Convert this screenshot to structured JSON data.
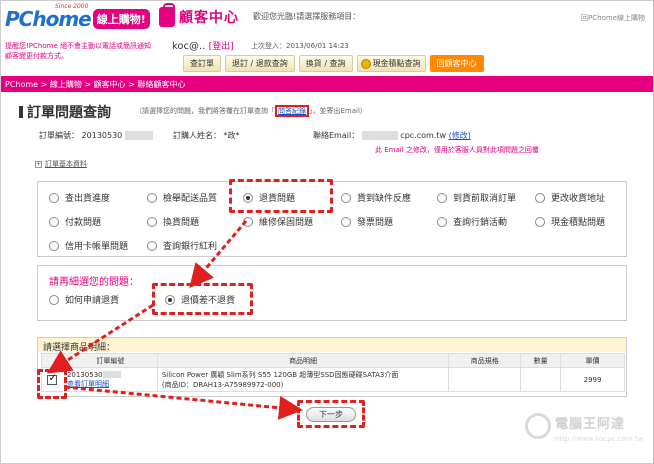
{
  "header": {
    "logo_text": "PChome",
    "since": "Since 2000",
    "shop_badge": "線上購物!",
    "cs_title": "顧客中心",
    "welcome": "歡迎您光臨!請選擇服務項目：",
    "top_link": "回PChome線上購物",
    "warning": "提醒您!PChome 絕不會主動以電話或簡訊通知顧客變更付款方式。",
    "user": "koc@..",
    "logout": "[登出]",
    "last_login": "上次登入：2013/06/01 14:23"
  },
  "tabs": [
    {
      "label": "查訂單"
    },
    {
      "label": "退訂 / 退款查詢"
    },
    {
      "label": "換貨 / 查詢"
    },
    {
      "label": "現金積點查詢"
    },
    {
      "label": "回顧客中心"
    }
  ],
  "breadcrumb": "PChome > 線上購物 > 顧客中心 > 聯絡顧客中心",
  "main": {
    "title": "訂單問題查詢",
    "hint_pre": "（請選擇您的問題，我們將答覆在訂單查詢「",
    "hint_link": "問答紀錄",
    "hint_post": "」，並寄出Email）",
    "order_no_label": "訂單編號：",
    "order_no_value": "20130530",
    "buyer_label": "訂購人姓名：",
    "buyer_value": "*政*",
    "email_label": "聯絡Email：",
    "email_value": "cpc.com.tw",
    "email_edit": "(修改)",
    "email_note": "此 Email 之修改，僅用於客服人員對此項問題之回覆",
    "order_basic": "訂單基本資料"
  },
  "problems": [
    {
      "label": "查出貨進度",
      "selected": false
    },
    {
      "label": "檢舉配送品質",
      "selected": false
    },
    {
      "label": "退貨問題",
      "selected": true
    },
    {
      "label": "貨到缺件反應",
      "selected": false
    },
    {
      "label": "到貨前取消訂單",
      "selected": false
    },
    {
      "label": "更改收貨地址",
      "selected": false
    },
    {
      "label": "付款問題",
      "selected": false
    },
    {
      "label": "換貨問題",
      "selected": false
    },
    {
      "label": "維修保固問題",
      "selected": false
    },
    {
      "label": "發票問題",
      "selected": false
    },
    {
      "label": "查詢行銷活動",
      "selected": false
    },
    {
      "label": "現金積點問題",
      "selected": false
    },
    {
      "label": "信用卡帳單問題",
      "selected": false
    },
    {
      "label": "查詢銀行紅利",
      "selected": false
    }
  ],
  "sub": {
    "question": "請再細選您的問題：",
    "options": [
      {
        "label": "如何申請退貨",
        "selected": false
      },
      {
        "label": "退價差不退貨",
        "selected": true
      }
    ]
  },
  "product": {
    "question": "請選擇商品明細：",
    "columns": [
      "訂單編號",
      "商品明細",
      "商品規格",
      "數量",
      "單價"
    ],
    "row": {
      "order_no": "20130530",
      "order_link": "查看訂單明細",
      "name": "Silicon Power 廣穎 Slim系列 S55 120GB 超薄型SSD固態硬碟SATA3介面",
      "item_id": "(商品ID：DRAH13-A75989972-000)",
      "spec": "",
      "qty": "",
      "price": "2999"
    }
  },
  "next_button": "下一步",
  "watermark": {
    "text": "電腦王阿達",
    "url": "http://www.kocpc.com.tw"
  },
  "colors": {
    "brand_pink": "#e4007f",
    "highlight_red": "#e0201f",
    "tab_active": "#ff8a00"
  }
}
